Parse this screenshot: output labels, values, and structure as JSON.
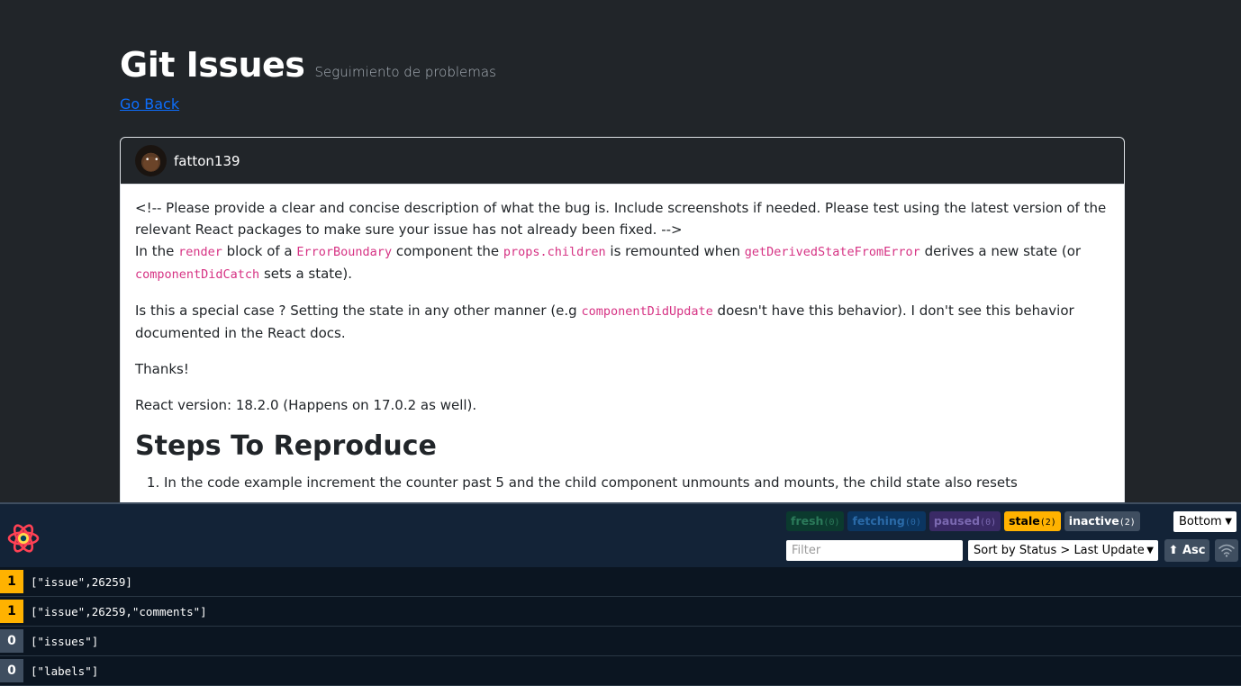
{
  "header": {
    "title": "Git Issues",
    "subtitle": "Seguimiento de problemas",
    "back_link": "Go Back"
  },
  "issue": {
    "username": "fatton139",
    "p1_a": "<!-- Please provide a clear and concise description of what the bug is. Include screenshots if needed. Please test using the latest version of the relevant React packages to make sure your issue has not already been fixed. -->",
    "p1_b": "In the ",
    "p1_code1": "render",
    "p1_c": " block of a ",
    "p1_code2": "ErrorBoundary",
    "p1_d": " component the ",
    "p1_code3": "props.children",
    "p1_e": " is remounted when ",
    "p1_code4": "getDerivedStateFromError",
    "p1_f": " derives a new state (or ",
    "p1_code5": "componentDidCatch",
    "p1_g": " sets a state).",
    "p2_a": "Is this a special case ? Setting the state in any other manner (e.g ",
    "p2_code": "componentDidUpdate",
    "p2_b": " doesn't have this behavior). I don't see this behavior documented in the React docs.",
    "p3": "Thanks!",
    "p4": "React version: 18.2.0 (Happens on 17.0.2 as well).",
    "h_steps": "Steps To Reproduce",
    "step1": "In the code example increment the counter past 5 and the child component unmounts and mounts, the child state also resets"
  },
  "devtools": {
    "badges": [
      {
        "label": "fresh",
        "count": "(0)"
      },
      {
        "label": "fetching",
        "count": "(0)"
      },
      {
        "label": "paused",
        "count": "(0)"
      },
      {
        "label": "stale",
        "count": "(2)"
      },
      {
        "label": "inactive",
        "count": "(2)"
      }
    ],
    "position": "Bottom",
    "filter_placeholder": "Filter",
    "sort": "Sort by Status > Last Updated",
    "asc_label": "⬆ Asc",
    "queries": [
      {
        "count": "1",
        "key": "[\"issue\",26259]",
        "status": "stale"
      },
      {
        "count": "1",
        "key": "[\"issue\",26259,\"comments\"]",
        "status": "stale"
      },
      {
        "count": "0",
        "key": "[\"issues\"]",
        "status": "inactive"
      },
      {
        "count": "0",
        "key": "[\"labels\"]",
        "status": "inactive"
      }
    ],
    "colors": {
      "stale": "#ffb200",
      "inactive": "#3f4e60",
      "logo": "#ff4154"
    }
  }
}
